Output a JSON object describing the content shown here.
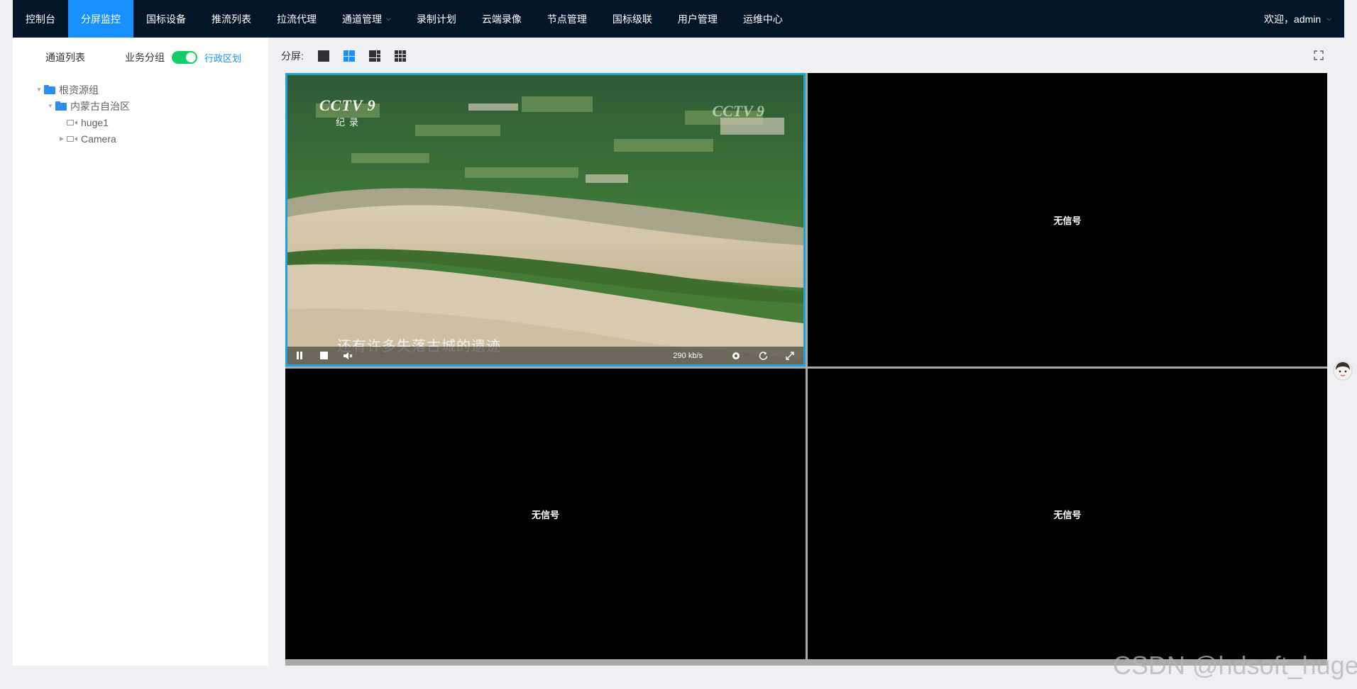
{
  "nav": {
    "items": [
      {
        "label": "控制台"
      },
      {
        "label": "分屏监控"
      },
      {
        "label": "国标设备"
      },
      {
        "label": "推流列表"
      },
      {
        "label": "拉流代理"
      },
      {
        "label": "通道管理"
      },
      {
        "label": "录制计划"
      },
      {
        "label": "云端录像"
      },
      {
        "label": "节点管理"
      },
      {
        "label": "国标级联"
      },
      {
        "label": "用户管理"
      },
      {
        "label": "运维中心"
      }
    ],
    "active": "分屏监控",
    "welcome": "欢迎，admin"
  },
  "sidebar": {
    "title": "通道列表",
    "group_label": "业务分组",
    "toggle_on": true,
    "region_label": "行政区划",
    "tree": [
      {
        "label": "根资源组",
        "type": "folder",
        "depth": 0,
        "expanded": true
      },
      {
        "label": "内蒙古自治区",
        "type": "folder",
        "depth": 1,
        "expanded": true
      },
      {
        "label": "huge1",
        "type": "camera",
        "depth": 2,
        "expanded": false
      },
      {
        "label": "Camera",
        "type": "camera",
        "depth": 2,
        "expanded": false
      }
    ]
  },
  "main": {
    "split_label": "分屏:",
    "split_options": [
      "1",
      "4",
      "6",
      "9"
    ],
    "split_active": "4"
  },
  "players": [
    {
      "state": "playing",
      "channel_logo": "CCTV 9",
      "channel_sub": "纪录",
      "subtitle": "还有许多失落古城的遗迹",
      "rate": "290 kb/s"
    },
    {
      "state": "no-signal",
      "text": "无信号"
    },
    {
      "state": "no-signal",
      "text": "无信号"
    },
    {
      "state": "no-signal",
      "text": "无信号"
    }
  ],
  "watermark": "CSDN @hdsoft_huge",
  "colors": {
    "topbar": "#031529",
    "active": "#1890ff",
    "switch": "#13ce66",
    "selected_border": "#1aa3d9"
  }
}
